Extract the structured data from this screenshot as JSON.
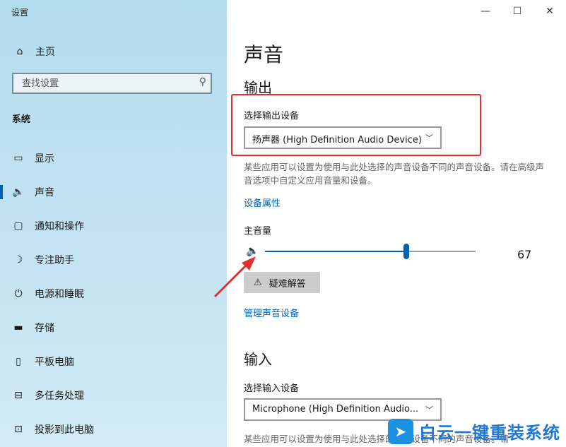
{
  "window": {
    "title": "设置",
    "minimize": "—",
    "maximize": "☐",
    "close": "✕"
  },
  "sidebar": {
    "home": {
      "label": "主页",
      "icon": "home-icon"
    },
    "search": {
      "placeholder": "查找设置",
      "icon": "search-icon"
    },
    "section": "系统",
    "items": [
      {
        "label": "显示",
        "icon": "monitor-icon",
        "glyph": "▭"
      },
      {
        "label": "声音",
        "icon": "speaker-icon",
        "glyph": "🔈",
        "active": true
      },
      {
        "label": "通知和操作",
        "icon": "message-icon",
        "glyph": "▢"
      },
      {
        "label": "专注助手",
        "icon": "moon-icon",
        "glyph": "☽"
      },
      {
        "label": "电源和睡眠",
        "icon": "power-icon",
        "glyph": "⏻"
      },
      {
        "label": "存储",
        "icon": "storage-icon",
        "glyph": "▬"
      },
      {
        "label": "平板电脑",
        "icon": "tablet-icon",
        "glyph": "▯"
      },
      {
        "label": "多任务处理",
        "icon": "multitask-icon",
        "glyph": "⊟"
      },
      {
        "label": "投影到此电脑",
        "icon": "project-icon",
        "glyph": "⊡"
      }
    ]
  },
  "main": {
    "title": "声音",
    "output": {
      "heading": "输出",
      "select_label": "选择输出设备",
      "device": "扬声器 (High Definition Audio Device)",
      "description": "某些应用可以设置为使用与此处选择的声音设备不同的声音设备。请在高级声音选项中自定义应用音量和设备。",
      "properties_link": "设备属性",
      "volume_label": "主音量",
      "volume": 67,
      "troubleshoot": "疑难解答",
      "manage_link": "管理声音设备"
    },
    "input": {
      "heading": "输入",
      "select_label": "选择输入设备",
      "device": "Microphone (High Definition Audio...",
      "description": "某些应用可以设置为使用与此处选择的声音设备不同的声音设备。请"
    }
  },
  "annotation": {
    "color": "#e0302f"
  },
  "watermark": {
    "text": "白云一键重装系统"
  }
}
